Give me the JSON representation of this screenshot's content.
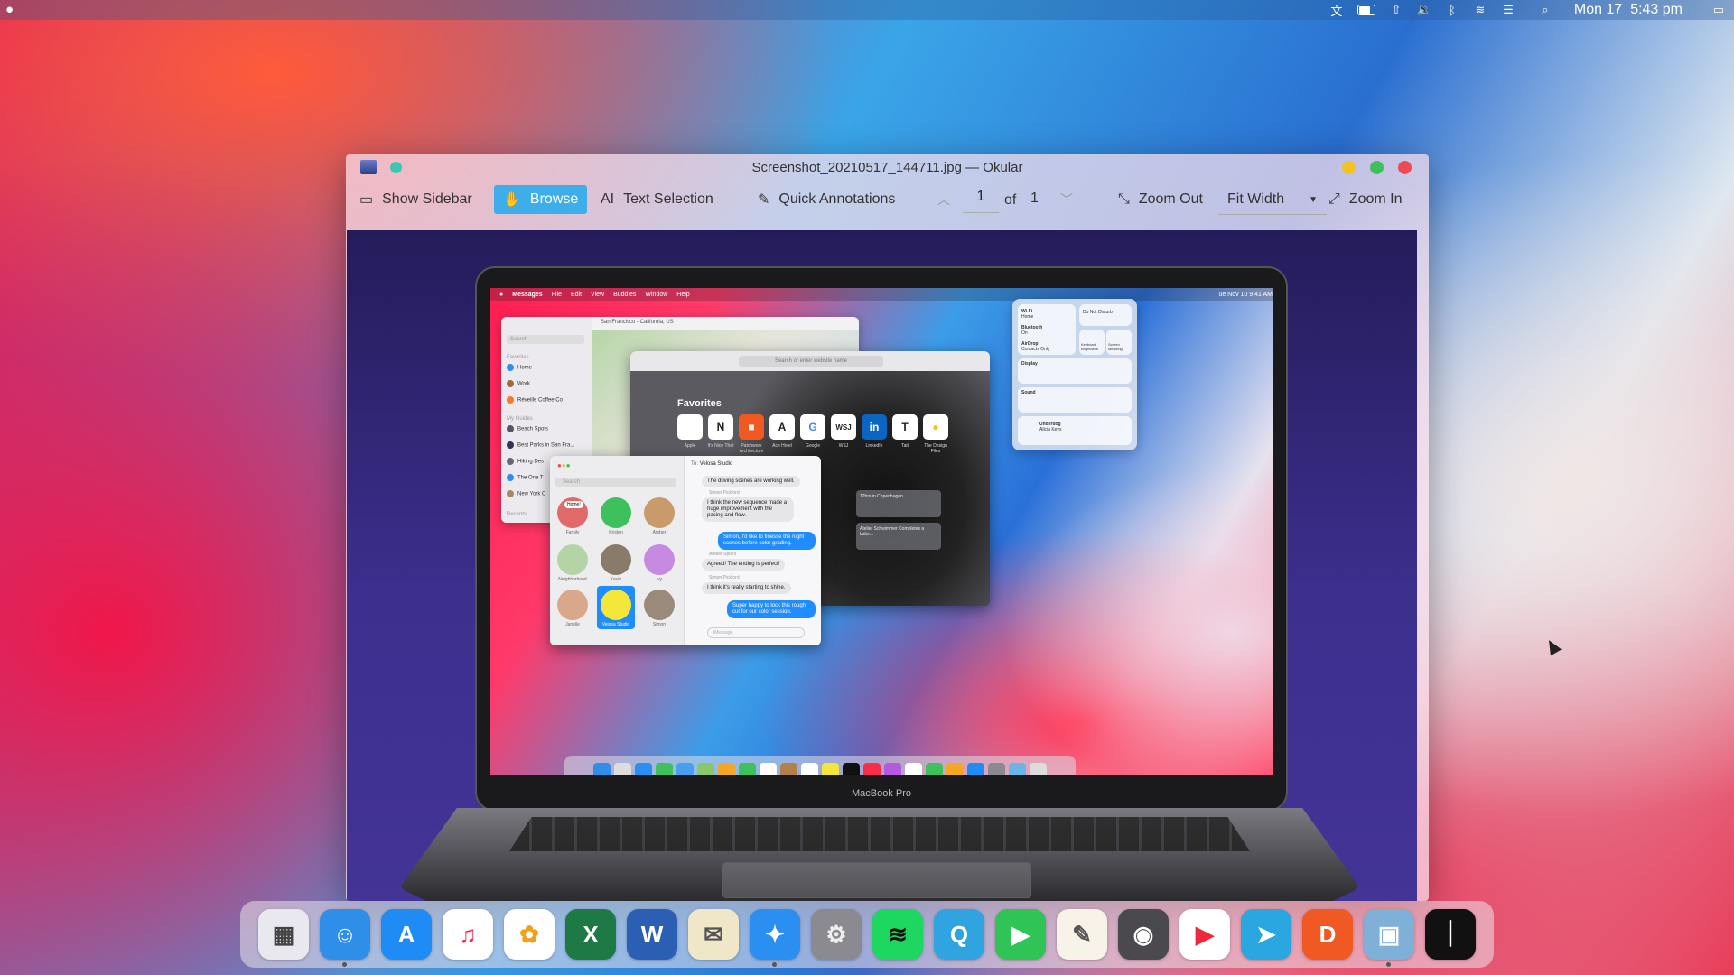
{
  "menubar": {
    "date": "Mon 17",
    "time": "5:43 pm"
  },
  "window": {
    "title": "Screenshot_20210517_144711.jpg — Okular",
    "toolbar": {
      "show_sidebar": "Show Sidebar",
      "browse": "Browse",
      "text_selection": "Text Selection",
      "quick_annotations": "Quick Annotations",
      "page_current": "1",
      "page_of": "of",
      "page_total": "1",
      "zoom_out": "Zoom Out",
      "zoom_mode": "Fit Width",
      "zoom_in": "Zoom In"
    }
  },
  "screenshot": {
    "laptop_label": "MacBook Pro",
    "inner_menu": [
      "Messages",
      "File",
      "Edit",
      "View",
      "Buddies",
      "Window",
      "Help"
    ],
    "inner_clock": "Tue Nov 10  9:41 AM",
    "maps": {
      "search": "Search",
      "title": "San Francisco - California, US",
      "favorites_header": "Favorites",
      "items": [
        "Home",
        "Work",
        "Réveille Coffee Co"
      ],
      "guides_header": "My Guides",
      "guides": [
        "Beach Spots",
        "Best Parks in San Fra...",
        "Hiking Des",
        "The One T",
        "New York C"
      ],
      "recents_header": "Recents"
    },
    "safari": {
      "url_placeholder": "Search or enter website name",
      "favorites_title": "Favorites",
      "tiles": [
        {
          "glyph": "",
          "label": "Apple"
        },
        {
          "glyph": "N",
          "label": "It's Nice That"
        },
        {
          "glyph": "■",
          "label": "Patchwork Architecture"
        },
        {
          "glyph": "A",
          "label": "Ace Hotel"
        },
        {
          "glyph": "G",
          "label": "Google"
        },
        {
          "glyph": "WSJ",
          "label": "WSJ"
        },
        {
          "glyph": "in",
          "label": "LinkedIn"
        },
        {
          "glyph": "T",
          "label": "Tait"
        },
        {
          "glyph": "●",
          "label": "The Design Files"
        }
      ],
      "reading_1": "12hrs in Copenhagen",
      "reading_2": "Atelier Schwimmer Completes a Lake..."
    },
    "messages": {
      "search": "Search",
      "to_label": "To:",
      "to_name": "Velosa Studio",
      "avatars": [
        "Family",
        "Kristen",
        "Amber",
        "Neighborhood",
        "Kevin",
        "Ivy",
        "Janelle",
        "Velosa Studio",
        "Simon"
      ],
      "bubbles": [
        {
          "from": "in",
          "sender": "",
          "text": "The driving scenes are working well."
        },
        {
          "from": "in",
          "sender": "Simon Pickford",
          "text": "I think the new sequence made a huge improvement with the pacing and flow."
        },
        {
          "from": "out",
          "sender": "",
          "text": "Simon, I'd like to finesse the night scenes before color grading."
        },
        {
          "from": "in",
          "sender": "Amber Spiers",
          "text": "Agreed! The ending is perfect!"
        },
        {
          "from": "in",
          "sender": "Simon Pickford",
          "text": "I think it's really starting to shine."
        },
        {
          "from": "out",
          "sender": "",
          "text": "Super happy to lock this rough cut for our color session."
        }
      ],
      "input_placeholder": "iMessage",
      "home_badge": "Home!"
    },
    "control_center": {
      "wifi": "Wi-Fi",
      "wifi_sub": "Home",
      "bluetooth": "Bluetooth",
      "bluetooth_sub": "On",
      "airdrop": "AirDrop",
      "airdrop_sub": "Contacts Only",
      "dnd": "Do Not Disturb",
      "keyboard": "Keyboard Brightness",
      "mirroring": "Screen Mirroring",
      "display": "Display",
      "sound": "Sound",
      "track": "Underdog",
      "artist": "Alicia Keys"
    }
  },
  "dock": [
    {
      "icon": "launchpad-icon",
      "glyph": "▦",
      "bg": "#e8e8ee",
      "fg": "#444"
    },
    {
      "icon": "finder-icon",
      "glyph": "☺",
      "bg": "#2f8fe8",
      "fg": "#fff"
    },
    {
      "icon": "app-store-icon",
      "glyph": "A",
      "bg": "#1f8cf5",
      "fg": "#fff"
    },
    {
      "icon": "music-icon",
      "glyph": "♫",
      "bg": "#ffffff",
      "fg": "#fa2d48"
    },
    {
      "icon": "photos-icon",
      "glyph": "✿",
      "bg": "#ffffff",
      "fg": "#f2a019"
    },
    {
      "icon": "excel-icon",
      "glyph": "X",
      "bg": "#1d7a45",
      "fg": "#fff"
    },
    {
      "icon": "word-icon",
      "glyph": "W",
      "bg": "#2b5fb3",
      "fg": "#fff"
    },
    {
      "icon": "preview-icon",
      "glyph": "✉",
      "bg": "#f0e6c8",
      "fg": "#555"
    },
    {
      "icon": "safari-icon",
      "glyph": "✦",
      "bg": "#2a8ff0",
      "fg": "#fff"
    },
    {
      "icon": "system-preferences-icon",
      "glyph": "⚙",
      "bg": "#8a8a90",
      "fg": "#eee"
    },
    {
      "icon": "spotify-icon",
      "glyph": "≋",
      "bg": "#1ed760",
      "fg": "#111"
    },
    {
      "icon": "quicktime-icon",
      "glyph": "Q",
      "bg": "#2fa4e0",
      "fg": "#fff"
    },
    {
      "icon": "facetime-icon",
      "glyph": "▶",
      "bg": "#2fc455",
      "fg": "#fff"
    },
    {
      "icon": "textedit-icon",
      "glyph": "✎",
      "bg": "#f7f3e8",
      "fg": "#555"
    },
    {
      "icon": "screenshot-icon",
      "glyph": "◉",
      "bg": "#4a4a4e",
      "fg": "#fff"
    },
    {
      "icon": "infuse-player-icon",
      "glyph": "▶",
      "bg": "#ffffff",
      "fg": "#ee2a3a"
    },
    {
      "icon": "telegram-icon",
      "glyph": "➤",
      "bg": "#2aa6e0",
      "fg": "#fff"
    },
    {
      "icon": "office-icon",
      "glyph": "D",
      "bg": "#f05a22",
      "fg": "#fff"
    },
    {
      "icon": "image-viewer-icon",
      "glyph": "▣",
      "bg": "#7fb0d8",
      "fg": "#fff"
    },
    {
      "icon": "clock-app-icon",
      "glyph": "⏐",
      "bg": "#111111",
      "fg": "#fff"
    }
  ]
}
